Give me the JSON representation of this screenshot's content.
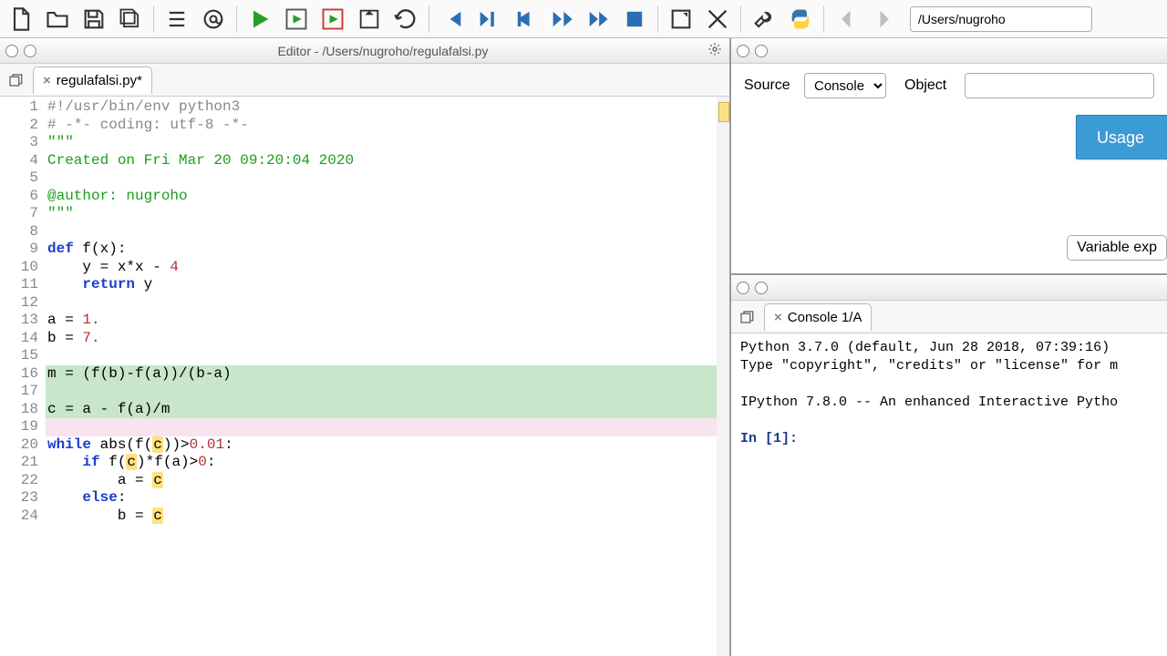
{
  "path_input": "/Users/nugroho",
  "editor": {
    "title": "Editor - /Users/nugroho/regulafalsi.py",
    "tab_label": "regulafalsi.py*",
    "lines": [
      {
        "n": 1,
        "segs": [
          {
            "t": "#!/usr/bin/env python3",
            "c": "cm"
          }
        ]
      },
      {
        "n": 2,
        "segs": [
          {
            "t": "# -*- coding: utf-8 -*-",
            "c": "cm"
          }
        ]
      },
      {
        "n": 3,
        "segs": [
          {
            "t": "\"\"\"",
            "c": "str"
          }
        ]
      },
      {
        "n": 4,
        "segs": [
          {
            "t": "Created on Fri Mar 20 09:20:04 2020",
            "c": "str"
          }
        ]
      },
      {
        "n": 5,
        "segs": [
          {
            "t": "",
            "c": ""
          }
        ]
      },
      {
        "n": 6,
        "segs": [
          {
            "t": "@author:",
            "c": "dec"
          },
          {
            "t": " nugroho",
            "c": "str"
          }
        ]
      },
      {
        "n": 7,
        "segs": [
          {
            "t": "\"\"\"",
            "c": "str"
          }
        ]
      },
      {
        "n": 8,
        "segs": [
          {
            "t": "",
            "c": ""
          }
        ]
      },
      {
        "n": 9,
        "segs": [
          {
            "t": "def",
            "c": "kw"
          },
          {
            "t": " f(x):",
            "c": ""
          }
        ]
      },
      {
        "n": 10,
        "segs": [
          {
            "t": "    y = x*x - ",
            "c": ""
          },
          {
            "t": "4",
            "c": "num"
          }
        ]
      },
      {
        "n": 11,
        "segs": [
          {
            "t": "    ",
            "c": ""
          },
          {
            "t": "return",
            "c": "kw"
          },
          {
            "t": " y",
            "c": ""
          }
        ]
      },
      {
        "n": 12,
        "segs": [
          {
            "t": "",
            "c": ""
          }
        ]
      },
      {
        "n": 13,
        "segs": [
          {
            "t": "a = ",
            "c": ""
          },
          {
            "t": "1.",
            "c": "num"
          }
        ]
      },
      {
        "n": 14,
        "segs": [
          {
            "t": "b = ",
            "c": ""
          },
          {
            "t": "7.",
            "c": "num"
          }
        ]
      },
      {
        "n": 15,
        "segs": [
          {
            "t": "",
            "c": ""
          }
        ]
      },
      {
        "n": 16,
        "hl": "hl-green",
        "segs": [
          {
            "t": "m = (f(b)-f(a))/(b-a)",
            "c": ""
          }
        ]
      },
      {
        "n": 17,
        "hl": "hl-green",
        "segs": [
          {
            "t": "",
            "c": ""
          }
        ]
      },
      {
        "n": 18,
        "hl": "hl-green",
        "segs": [
          {
            "t": "c = a - f(a)/m",
            "c": ""
          }
        ]
      },
      {
        "n": 19,
        "hl": "hl-pink",
        "segs": [
          {
            "t": "",
            "c": ""
          }
        ]
      },
      {
        "n": 20,
        "segs": [
          {
            "t": "while",
            "c": "kw"
          },
          {
            "t": " abs(f(",
            "c": ""
          },
          {
            "t": "c",
            "c": "hlvar"
          },
          {
            "t": "))>",
            "c": ""
          },
          {
            "t": "0.01",
            "c": "num"
          },
          {
            "t": ":",
            "c": ""
          }
        ]
      },
      {
        "n": 21,
        "segs": [
          {
            "t": "    ",
            "c": ""
          },
          {
            "t": "if",
            "c": "kw"
          },
          {
            "t": " f(",
            "c": ""
          },
          {
            "t": "c",
            "c": "hlvar"
          },
          {
            "t": ")*f(a)>",
            "c": ""
          },
          {
            "t": "0",
            "c": "num"
          },
          {
            "t": ":",
            "c": ""
          }
        ]
      },
      {
        "n": 22,
        "segs": [
          {
            "t": "        a = ",
            "c": ""
          },
          {
            "t": "c",
            "c": "hlvar"
          }
        ]
      },
      {
        "n": 23,
        "segs": [
          {
            "t": "    ",
            "c": ""
          },
          {
            "t": "else",
            "c": "kw"
          },
          {
            "t": ":",
            "c": ""
          }
        ]
      },
      {
        "n": 24,
        "segs": [
          {
            "t": "        b = ",
            "c": ""
          },
          {
            "t": "c",
            "c": "hlvar"
          }
        ]
      }
    ]
  },
  "right_top": {
    "source_label": "Source",
    "source_value": "Console",
    "object_label": "Object",
    "usage_label": "Usage",
    "varexp_label": "Variable exp"
  },
  "console": {
    "tab_label": "Console 1/A",
    "banner1": "Python 3.7.0 (default, Jun 28 2018, 07:39:16) ",
    "banner2": "Type \"copyright\", \"credits\" or \"license\" for m",
    "banner3": "IPython 7.8.0 -- An enhanced Interactive Pytho",
    "prompt": "In [1]: "
  },
  "icons": {
    "new": "new-file-icon",
    "open": "open-folder-icon",
    "save": "save-icon",
    "saveall": "save-all-icon",
    "list": "list-icon",
    "at": "at-icon",
    "run": "run-icon",
    "runcell": "run-cell-icon",
    "runcelladv": "run-cell-advance-icon",
    "debug": "debug-icon",
    "rerun": "rerun-icon",
    "first": "skip-first-icon",
    "stepin": "step-in-icon",
    "stepover": "step-over-icon",
    "stepout": "step-out-icon",
    "next": "skip-next-icon",
    "stop": "stop-icon",
    "maximize": "maximize-icon",
    "fullscreen": "fullscreen-icon",
    "wrench": "wrench-icon",
    "python": "python-icon",
    "back": "back-icon",
    "fwd": "forward-icon",
    "gear": "gear-icon",
    "restore": "restore-icon",
    "close": "close-icon"
  }
}
